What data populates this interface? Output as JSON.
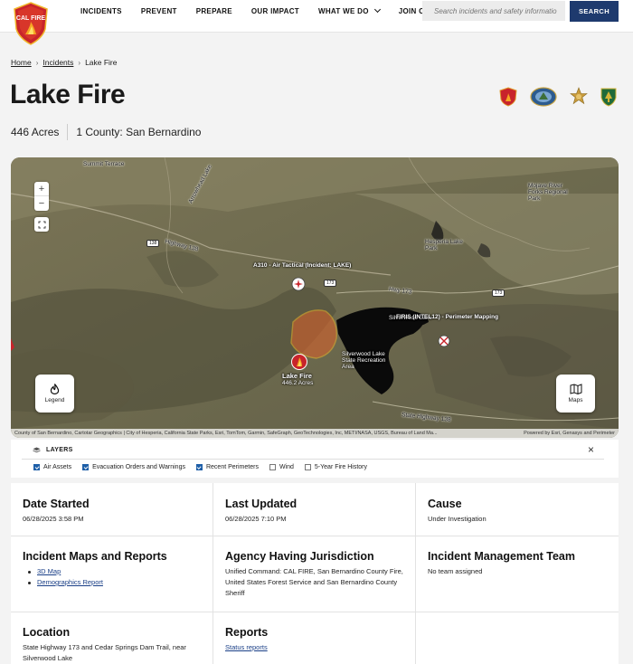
{
  "header": {
    "nav": [
      "INCIDENTS",
      "PREVENT",
      "PREPARE",
      "OUR IMPACT",
      "WHAT WE DO",
      "JOIN CAL FIRE"
    ],
    "search_placeholder": "Search incidents and safety informatio",
    "search_button": "SEARCH",
    "logo_text": "CAL FIRE"
  },
  "breadcrumb": [
    "Home",
    "Incidents",
    "Lake Fire"
  ],
  "incident": {
    "title": "Lake Fire",
    "acres": "446 Acres",
    "county": "1 County: San Bernardino"
  },
  "map": {
    "legend_label": "Legend",
    "maps_label": "Maps",
    "fire_label": "Lake Fire",
    "fire_acres": "446.2 Acres",
    "aircraft_label": "A310 - Air Tactical (Incident: LAKE)",
    "perimeter_label": "FIRIS (INTEL12) - Perimeter Mapping",
    "place_labels": [
      "Summit Terrace",
      "Silverwood Lake State Recreation Area",
      "Silverwood Lake",
      "Hesperia Lake Park",
      "Mojave River Forks Regional Park",
      "Highway 138",
      "Arrowhead Lake"
    ],
    "road_labels": [
      "138",
      "173",
      "173",
      "Hwy 173",
      "State Highway 138"
    ],
    "attribution_left": "County of San Bernardino, Cartotar Geographics | City of Hesperia, California State Parks, Esri, TomTom, Garmin, SafeGraph, GeoTechnologies, Inc, METI/NASA, USGS, Bureau of Land Ma...",
    "attribution_right": "Powered by Esri, Genasys and Perimeter"
  },
  "layers": {
    "title": "LAYERS",
    "options": [
      {
        "label": "Air Assets",
        "checked": true
      },
      {
        "label": "Evacuation Orders and Warnings",
        "checked": true
      },
      {
        "label": "Recent Perimeters",
        "checked": true
      },
      {
        "label": "Wind",
        "checked": false
      },
      {
        "label": "5-Year Fire History",
        "checked": false
      }
    ]
  },
  "details": {
    "date_started": {
      "label": "Date Started",
      "value": "06/28/2025 3:58 PM"
    },
    "last_updated": {
      "label": "Last Updated",
      "value": "06/28/2025 7:10 PM"
    },
    "cause": {
      "label": "Cause",
      "value": "Under Investigation"
    },
    "maps_reports": {
      "label": "Incident Maps and Reports",
      "links": [
        "3D Map",
        "Demographics Report"
      ]
    },
    "agency": {
      "label": "Agency Having Jurisdiction",
      "value": "Unified Command: CAL FIRE, San Bernardino County Fire, United States Forest Service and San Bernardino County Sheriff"
    },
    "team": {
      "label": "Incident Management Team",
      "value": "No team assigned"
    },
    "location": {
      "label": "Location",
      "value": "State Highway 173 and Cedar Springs Dam Trail, near Silverwood Lake"
    },
    "reports": {
      "label": "Reports",
      "link": "Status reports"
    }
  },
  "colors": {
    "nav_blue": "#1e3a6e",
    "link_blue": "#1a3f87",
    "fire_orange": "#e0622a",
    "logo_red": "#c8242b"
  }
}
